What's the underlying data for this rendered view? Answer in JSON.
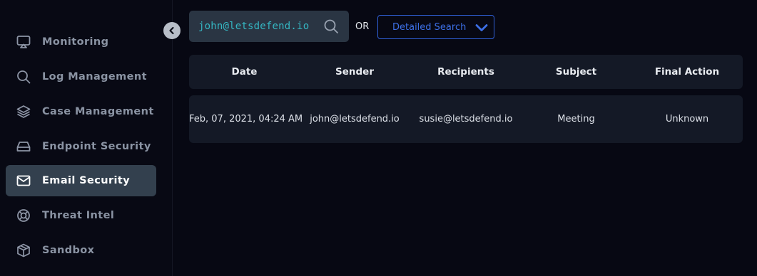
{
  "sidebar": {
    "items": [
      {
        "label": "Monitoring",
        "icon": "monitor-icon"
      },
      {
        "label": "Log Management",
        "icon": "search-icon"
      },
      {
        "label": "Case Management",
        "icon": "layers-icon"
      },
      {
        "label": "Endpoint Security",
        "icon": "drive-icon"
      },
      {
        "label": "Email Security",
        "icon": "mail-icon",
        "active": true
      },
      {
        "label": "Threat Intel",
        "icon": "lifebuoy-icon"
      },
      {
        "label": "Sandbox",
        "icon": "box-icon"
      }
    ]
  },
  "search": {
    "value": "john@letsdefend.io",
    "or_label": "OR",
    "detailed_label": "Detailed Search"
  },
  "table": {
    "headers": [
      "Date",
      "Sender",
      "Recipients",
      "Subject",
      "Final Action"
    ],
    "rows": [
      {
        "date": "Feb, 07, 2021, 04:24 AM",
        "sender": "john@letsdefend.io",
        "recipients": "susie@letsdefend.io",
        "subject": "Meeting",
        "final_action": "Unknown"
      }
    ]
  },
  "colors": {
    "background": "#070813",
    "active_item": "#33404e",
    "accent_blue": "#3c6fe6",
    "search_text": "#35b7c3"
  }
}
